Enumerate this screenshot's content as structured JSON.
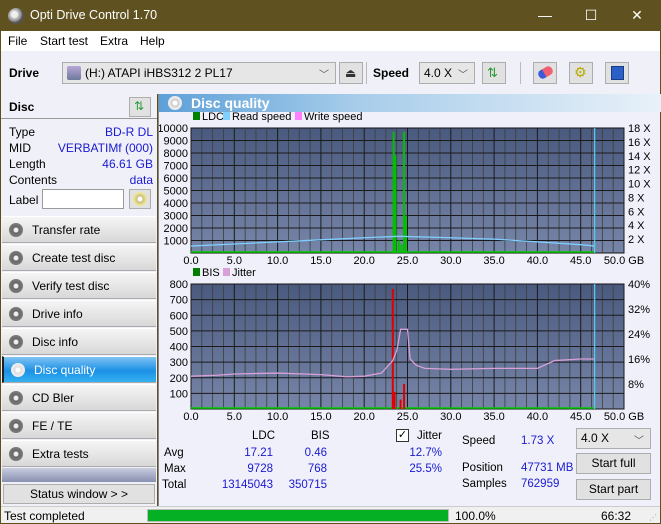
{
  "window": {
    "title": "Opti Drive Control 1.70",
    "minimize": "—",
    "maximize": "☐",
    "close": "✕"
  },
  "menu": [
    "File",
    "Start test",
    "Extra",
    "Help"
  ],
  "toolbar": {
    "drive_label": "Drive",
    "drive_value": "(H:)  ATAPI iHBS312  2 PL17",
    "speed_label": "Speed",
    "speed_value": "4.0 X",
    "icons": [
      "eject-icon",
      "refresh-icon",
      "erase-icon",
      "settings-icon",
      "save-icon"
    ]
  },
  "disc": {
    "header": "Disc",
    "fields": [
      {
        "key": "Type",
        "value": "BD-R DL"
      },
      {
        "key": "MID",
        "value": "VERBATIMf (000)"
      },
      {
        "key": "Length",
        "value": "46.61 GB"
      },
      {
        "key": "Contents",
        "value": "data"
      }
    ],
    "label_key": "Label",
    "label_value": ""
  },
  "nav": [
    {
      "label": "Transfer rate",
      "active": false
    },
    {
      "label": "Create test disc",
      "active": false
    },
    {
      "label": "Verify test disc",
      "active": false
    },
    {
      "label": "Drive info",
      "active": false
    },
    {
      "label": "Disc info",
      "active": false
    },
    {
      "label": "Disc quality",
      "active": true
    },
    {
      "label": "CD Bler",
      "active": false
    },
    {
      "label": "FE / TE",
      "active": false
    },
    {
      "label": "Extra tests",
      "active": false
    }
  ],
  "status_window_btn": "Status window > >",
  "panel_title": "Disc quality",
  "colors": {
    "ldc": "#00c000",
    "read_speed": "#7fcfff",
    "write_speed": "#ff80ff",
    "bis": "#e00000",
    "jitter": "#d8a0d8",
    "progress": "#06b025",
    "value_blue": "#1a1ad0"
  },
  "chart_data": [
    {
      "type": "bar",
      "title": "LDC",
      "legend": [
        "LDC",
        "Read speed",
        "Write speed"
      ],
      "xlabel": "GB",
      "x_ticks": [
        "0.0",
        "5.0",
        "10.0",
        "15.0",
        "20.0",
        "25.0",
        "30.0",
        "35.0",
        "40.0",
        "45.0",
        "50.0 GB"
      ],
      "xlim": [
        0,
        50
      ],
      "y_ticks": [
        "1000",
        "2000",
        "3000",
        "4000",
        "5000",
        "6000",
        "7000",
        "8000",
        "9000",
        "10000"
      ],
      "ylim": [
        0,
        10000
      ],
      "y2_ticks": [
        "2 X",
        "4 X",
        "6 X",
        "8 X",
        "10 X",
        "12 X",
        "14 X",
        "16 X",
        "18 X"
      ],
      "y2lim": [
        0,
        18
      ],
      "ldc_spikes": [
        [
          23.4,
          9700
        ],
        [
          23.6,
          7800
        ],
        [
          24.6,
          9700
        ],
        [
          24.8,
          3000
        ],
        [
          24.0,
          1000
        ],
        [
          24.3,
          700
        ]
      ],
      "read_speed": [
        [
          0,
          1.0
        ],
        [
          5,
          1.3
        ],
        [
          10,
          1.6
        ],
        [
          15,
          1.9
        ],
        [
          20,
          2.2
        ],
        [
          24,
          2.4
        ],
        [
          30,
          2.2
        ],
        [
          35,
          2.0
        ],
        [
          40,
          1.6
        ],
        [
          45,
          1.2
        ],
        [
          46.6,
          1.0
        ]
      ],
      "end_marker_gb": 46.61
    },
    {
      "type": "bar",
      "title": "BIS",
      "legend": [
        "BIS",
        "Jitter"
      ],
      "xlabel": "GB",
      "x_ticks": [
        "0.0",
        "5.0",
        "10.0",
        "15.0",
        "20.0",
        "25.0",
        "30.0",
        "35.0",
        "40.0",
        "45.0",
        "50.0 GB"
      ],
      "xlim": [
        0,
        50
      ],
      "y_ticks": [
        "100",
        "200",
        "300",
        "400",
        "500",
        "600",
        "700",
        "800"
      ],
      "ylim": [
        0,
        800
      ],
      "y2_ticks": [
        "8%",
        "16%",
        "24%",
        "32%",
        "40%"
      ],
      "y2lim": [
        0,
        40
      ],
      "bis_spikes": [
        [
          23.3,
          768
        ],
        [
          23.5,
          110
        ],
        [
          24.6,
          160
        ],
        [
          24.2,
          60
        ]
      ],
      "jitter": [
        [
          0,
          10.5
        ],
        [
          3,
          10.8
        ],
        [
          5,
          11.2
        ],
        [
          10,
          11.5
        ],
        [
          15,
          11.0
        ],
        [
          18,
          10.3
        ],
        [
          20,
          10.5
        ],
        [
          22,
          11.5
        ],
        [
          23.3,
          15.5
        ],
        [
          23.8,
          19
        ],
        [
          24.2,
          25.5
        ],
        [
          25,
          25.5
        ],
        [
          25.3,
          16
        ],
        [
          26,
          14
        ],
        [
          27,
          13
        ],
        [
          30,
          12.7
        ],
        [
          35,
          13
        ],
        [
          40,
          13
        ],
        [
          42,
          15.5
        ],
        [
          45,
          16
        ],
        [
          46.6,
          16
        ]
      ],
      "end_marker_gb": 46.61
    }
  ],
  "stats": {
    "cols": [
      "LDC",
      "BIS"
    ],
    "rows": [
      {
        "label": "Avg",
        "ldc": "17.21",
        "bis": "0.46",
        "jitter": "12.7%"
      },
      {
        "label": "Max",
        "ldc": "9728",
        "bis": "768",
        "jitter": "25.5%"
      },
      {
        "label": "Total",
        "ldc": "13145043",
        "bis": "350715"
      }
    ],
    "jitter_label": "Jitter",
    "jitter_checked": true,
    "speed_label": "Speed",
    "speed_value": "1.73 X",
    "position_label": "Position",
    "position_value": "47731 MB",
    "samples_label": "Samples",
    "samples_value": "762959",
    "speed_select": "4.0 X",
    "start_full": "Start full",
    "start_part": "Start part"
  },
  "statusbar": {
    "text": "Test completed",
    "progress": 100.0,
    "progress_text": "100.0%",
    "time": "66:32"
  }
}
